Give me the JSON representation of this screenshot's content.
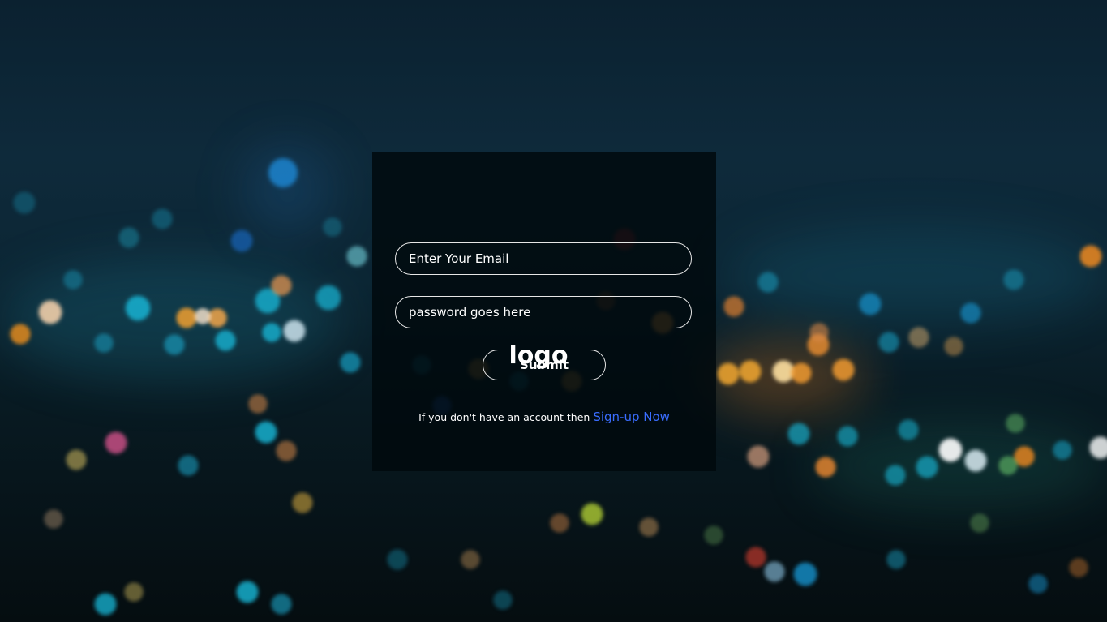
{
  "login": {
    "logo_text": "logo",
    "email_placeholder": "Enter Your Email",
    "password_placeholder": "password goes here",
    "submit_label": "Submit",
    "signup_prompt": "If you don't have an account then",
    "signup_link": "Sign-up Now"
  },
  "colors": {
    "link": "#3a6dff",
    "card_background": "#00080c"
  }
}
